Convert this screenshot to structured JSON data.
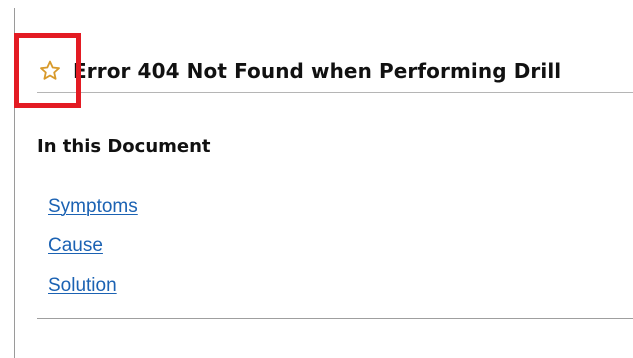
{
  "document": {
    "title": "Error 404 Not Found when Performing Drill",
    "section_heading": "In this Document",
    "toc_links": [
      {
        "label": "Symptoms"
      },
      {
        "label": "Cause"
      },
      {
        "label": "Solution"
      }
    ]
  },
  "icons": {
    "favorite": "star-icon"
  },
  "colors": {
    "highlight": "#e31b23",
    "link": "#1b62b3",
    "star": "#d89a2b"
  }
}
